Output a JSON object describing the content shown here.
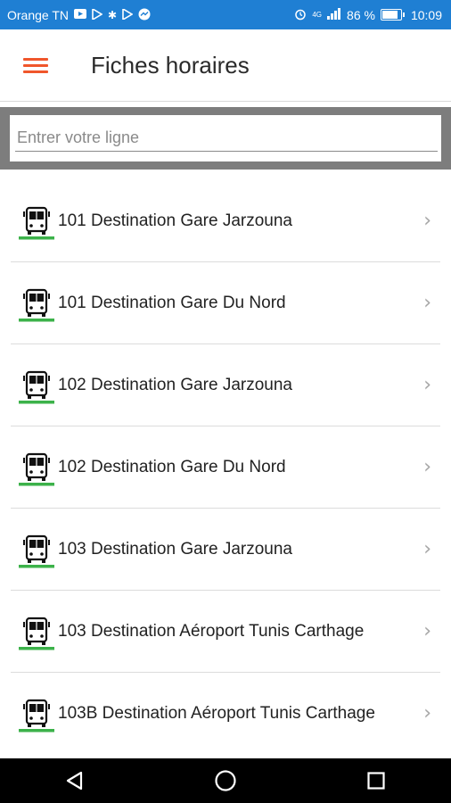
{
  "status_bar": {
    "carrier": "Orange TN",
    "battery_percent": "86 %",
    "network": "4G",
    "time": "10:09",
    "bg_color": "#1f7fd3"
  },
  "app_bar": {
    "title": "Fiches horaires",
    "menu_icon": "hamburger-menu-icon",
    "accent_color": "#f0562b"
  },
  "search": {
    "placeholder": "Entrer votre ligne",
    "value": ""
  },
  "routes": [
    {
      "label": "101 Destination Gare Jarzouna",
      "icon": "bus-icon"
    },
    {
      "label": "101 Destination Gare Du Nord",
      "icon": "bus-icon"
    },
    {
      "label": "102 Destination Gare Jarzouna",
      "icon": "bus-icon"
    },
    {
      "label": "102 Destination Gare Du Nord",
      "icon": "bus-icon"
    },
    {
      "label": "103 Destination Gare Jarzouna",
      "icon": "bus-icon"
    },
    {
      "label": "103 Destination Aéroport Tunis Carthage",
      "icon": "bus-icon"
    },
    {
      "label": "103B Destination Aéroport Tunis Carthage",
      "icon": "bus-icon"
    }
  ],
  "colors": {
    "bus_underline": "#3cb24a"
  },
  "nav_bar": {
    "buttons": [
      "back-icon",
      "home-icon",
      "recents-icon"
    ]
  }
}
